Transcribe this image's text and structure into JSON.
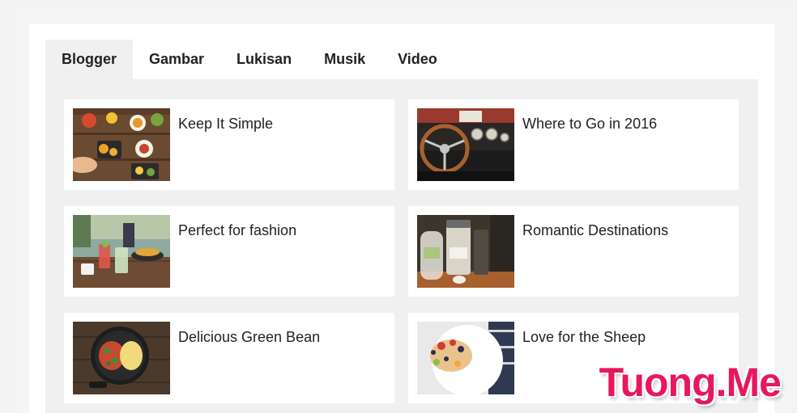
{
  "tabs": [
    {
      "label": "Blogger",
      "active": true
    },
    {
      "label": "Gambar",
      "active": false
    },
    {
      "label": "Lukisan",
      "active": false
    },
    {
      "label": "Musik",
      "active": false
    },
    {
      "label": "Video",
      "active": false
    }
  ],
  "posts": [
    {
      "title": "Keep It Simple",
      "image": "food-table-photo"
    },
    {
      "title": "Where to Go in 2016",
      "image": "car-dashboard-photo"
    },
    {
      "title": "Perfect for fashion",
      "image": "cafe-drinks-photo"
    },
    {
      "title": "Romantic Destinations",
      "image": "salt-jars-photo"
    },
    {
      "title": "Delicious Green Bean",
      "image": "pan-dish-photo"
    },
    {
      "title": "Love for the Sheep",
      "image": "fruit-pancake-photo"
    }
  ],
  "watermark": "Tuong.Me",
  "colors": {
    "watermark": "#e8175d",
    "active_tab_bg": "#f0f0f0",
    "content_bg": "#f0f0f0"
  }
}
